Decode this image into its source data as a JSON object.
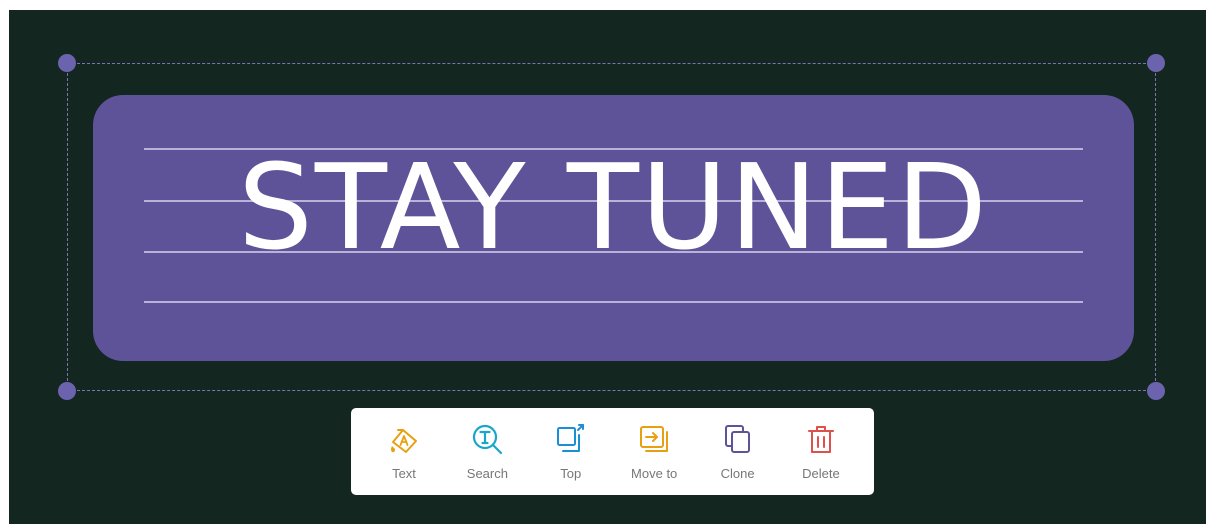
{
  "banner": {
    "text": "STAY TUNED",
    "color": "#5e5399",
    "text_color": "#ffffff"
  },
  "canvas": {
    "background": "#13261f"
  },
  "toolbar": {
    "items": [
      {
        "label": "Text",
        "icon": "text-fill-icon",
        "color": "#e8a012"
      },
      {
        "label": "Search",
        "icon": "search-text-icon",
        "color": "#1aa6c8"
      },
      {
        "label": "Top",
        "icon": "bring-to-top-icon",
        "color": "#1a8fd8"
      },
      {
        "label": "Move to",
        "icon": "move-to-icon",
        "color": "#e8a012"
      },
      {
        "label": "Clone",
        "icon": "clone-icon",
        "color": "#5e5399"
      },
      {
        "label": "Delete",
        "icon": "delete-icon",
        "color": "#e0504a"
      }
    ]
  }
}
